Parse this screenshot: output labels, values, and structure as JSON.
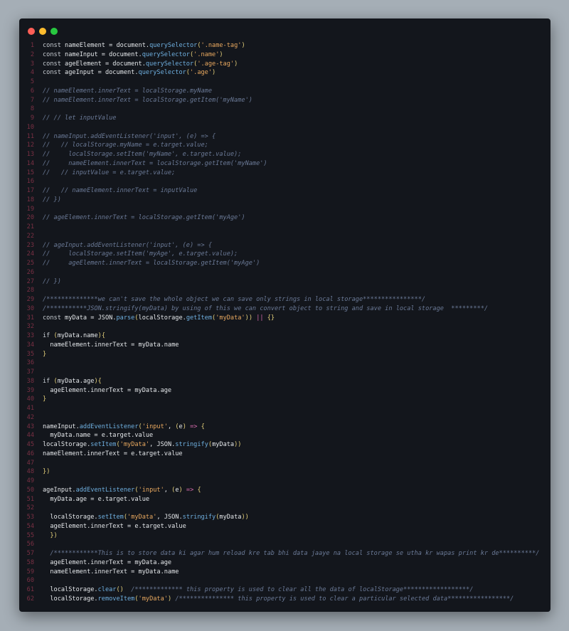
{
  "window": {
    "buttons": {
      "close": "close",
      "minimize": "minimize",
      "maximize": "maximize"
    },
    "colors": {
      "background": "#13161c",
      "line_number": "#7a3044",
      "comment": "#6b7a97",
      "string": "#e8a85f",
      "method": "#6fb0e0",
      "text": "#e4e7ea"
    }
  },
  "code": {
    "lines": [
      {
        "n": "1",
        "t": "const nameElement = document.querySelector('.name-tag')"
      },
      {
        "n": "2",
        "t": "const nameInput = document.querySelector('.name')"
      },
      {
        "n": "3",
        "t": "const ageElement = document.querySelector('.age-tag')"
      },
      {
        "n": "4",
        "t": "const ageInput = document.querySelector('.age')"
      },
      {
        "n": "5",
        "t": ""
      },
      {
        "n": "6",
        "t": "// nameElement.innerText = localStorage.myName"
      },
      {
        "n": "7",
        "t": "// nameElement.innerText = localStorage.getItem('myName')"
      },
      {
        "n": "8",
        "t": ""
      },
      {
        "n": "9",
        "t": "// // let inputValue"
      },
      {
        "n": "10",
        "t": ""
      },
      {
        "n": "11",
        "t": "// nameInput.addEventListener('input', (e) => {"
      },
      {
        "n": "12",
        "t": "//   // localStorage.myName = e.target.value;"
      },
      {
        "n": "13",
        "t": "//     localStorage.setItem('myName', e.target.value);"
      },
      {
        "n": "14",
        "t": "//     nameElement.innerText = localStorage.getItem('myName')"
      },
      {
        "n": "15",
        "t": "//   // inputValue = e.target.value;"
      },
      {
        "n": "16",
        "t": ""
      },
      {
        "n": "17",
        "t": "//   // nameElement.innerText = inputValue"
      },
      {
        "n": "18",
        "t": "// })"
      },
      {
        "n": "19",
        "t": ""
      },
      {
        "n": "20",
        "t": "// ageElement.innerText = localStorage.getItem('myAge')"
      },
      {
        "n": "21",
        "t": ""
      },
      {
        "n": "22",
        "t": ""
      },
      {
        "n": "23",
        "t": "// ageInput.addEventListener('input', (e) => {"
      },
      {
        "n": "24",
        "t": "//     localStorage.setItem('myAge', e.target.value);"
      },
      {
        "n": "25",
        "t": "//     ageElement.innerText = localStorage.getItem('myAge')"
      },
      {
        "n": "26",
        "t": ""
      },
      {
        "n": "27",
        "t": "// })"
      },
      {
        "n": "28",
        "t": ""
      },
      {
        "n": "29",
        "t": "/**************we can't save the whole object we can save only strings in local storage****************/"
      },
      {
        "n": "30",
        "t": "/***********JSON.stringify(myData) by using of this we can convert object to string and save in local storage  *********/"
      },
      {
        "n": "31",
        "t": "const myData = JSON.parse(localStorage.getItem('myData')) || {}"
      },
      {
        "n": "32",
        "t": ""
      },
      {
        "n": "33",
        "t": "if (myData.name){"
      },
      {
        "n": "34",
        "t": "  nameElement.innerText = myData.name"
      },
      {
        "n": "35",
        "t": "}"
      },
      {
        "n": "36",
        "t": ""
      },
      {
        "n": "37",
        "t": ""
      },
      {
        "n": "38",
        "t": "if (myData.age){"
      },
      {
        "n": "39",
        "t": "  ageElement.innerText = myData.age"
      },
      {
        "n": "40",
        "t": "}"
      },
      {
        "n": "41",
        "t": ""
      },
      {
        "n": "42",
        "t": ""
      },
      {
        "n": "43",
        "t": "nameInput.addEventListener('input', (e) => {"
      },
      {
        "n": "44",
        "t": "  myData.name = e.target.value"
      },
      {
        "n": "45",
        "t": "localStorage.setItem('myData', JSON.stringify(myData))"
      },
      {
        "n": "46",
        "t": "nameElement.innerText = e.target.value"
      },
      {
        "n": "47",
        "t": ""
      },
      {
        "n": "48",
        "t": "})"
      },
      {
        "n": "49",
        "t": ""
      },
      {
        "n": "50",
        "t": "ageInput.addEventListener('input', (e) => {"
      },
      {
        "n": "51",
        "t": "  myData.age = e.target.value"
      },
      {
        "n": "52",
        "t": ""
      },
      {
        "n": "53",
        "t": "  localStorage.setItem('myData', JSON.stringify(myData))"
      },
      {
        "n": "54",
        "t": "  ageElement.innerText = e.target.value"
      },
      {
        "n": "55",
        "t": "  })"
      },
      {
        "n": "56",
        "t": ""
      },
      {
        "n": "57",
        "t": "  /************This is to store data ki agar hum reload kre tab bhi data jaaye na local storage se utha kr wapas print kr de**********/"
      },
      {
        "n": "58",
        "t": "  ageElement.innerText = myData.age"
      },
      {
        "n": "59",
        "t": "  nameElement.innerText = myData.name"
      },
      {
        "n": "60",
        "t": ""
      },
      {
        "n": "61",
        "t": "  localStorage.clear()  /************* this property is used to clear all the data of localStorage******************/"
      },
      {
        "n": "62",
        "t": "  localStorage.removeItem('myData') /*************** this property is used to clear a particular selected data*****************/"
      }
    ]
  }
}
